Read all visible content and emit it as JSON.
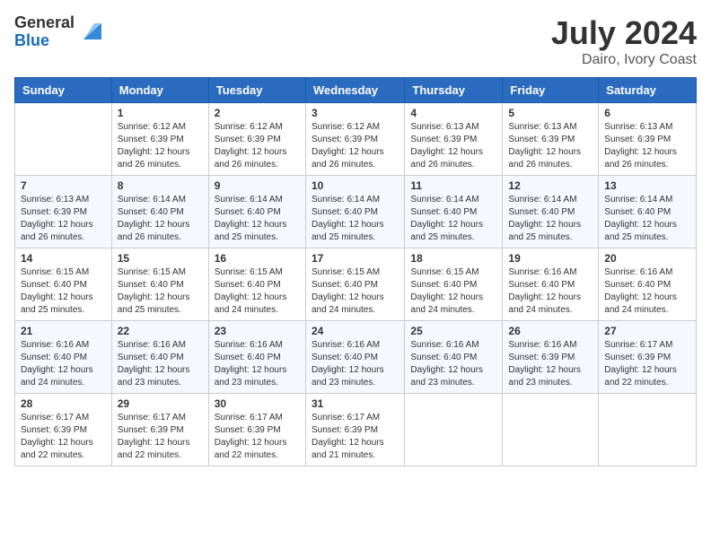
{
  "header": {
    "logo_general": "General",
    "logo_blue": "Blue",
    "month": "July 2024",
    "location": "Dairo, Ivory Coast"
  },
  "days_of_week": [
    "Sunday",
    "Monday",
    "Tuesday",
    "Wednesday",
    "Thursday",
    "Friday",
    "Saturday"
  ],
  "weeks": [
    [
      {
        "day": "",
        "sunrise": "",
        "sunset": "",
        "daylight": ""
      },
      {
        "day": "1",
        "sunrise": "Sunrise: 6:12 AM",
        "sunset": "Sunset: 6:39 PM",
        "daylight": "Daylight: 12 hours and 26 minutes."
      },
      {
        "day": "2",
        "sunrise": "Sunrise: 6:12 AM",
        "sunset": "Sunset: 6:39 PM",
        "daylight": "Daylight: 12 hours and 26 minutes."
      },
      {
        "day": "3",
        "sunrise": "Sunrise: 6:12 AM",
        "sunset": "Sunset: 6:39 PM",
        "daylight": "Daylight: 12 hours and 26 minutes."
      },
      {
        "day": "4",
        "sunrise": "Sunrise: 6:13 AM",
        "sunset": "Sunset: 6:39 PM",
        "daylight": "Daylight: 12 hours and 26 minutes."
      },
      {
        "day": "5",
        "sunrise": "Sunrise: 6:13 AM",
        "sunset": "Sunset: 6:39 PM",
        "daylight": "Daylight: 12 hours and 26 minutes."
      },
      {
        "day": "6",
        "sunrise": "Sunrise: 6:13 AM",
        "sunset": "Sunset: 6:39 PM",
        "daylight": "Daylight: 12 hours and 26 minutes."
      }
    ],
    [
      {
        "day": "7",
        "sunrise": "Sunrise: 6:13 AM",
        "sunset": "Sunset: 6:39 PM",
        "daylight": "Daylight: 12 hours and 26 minutes."
      },
      {
        "day": "8",
        "sunrise": "Sunrise: 6:14 AM",
        "sunset": "Sunset: 6:40 PM",
        "daylight": "Daylight: 12 hours and 26 minutes."
      },
      {
        "day": "9",
        "sunrise": "Sunrise: 6:14 AM",
        "sunset": "Sunset: 6:40 PM",
        "daylight": "Daylight: 12 hours and 25 minutes."
      },
      {
        "day": "10",
        "sunrise": "Sunrise: 6:14 AM",
        "sunset": "Sunset: 6:40 PM",
        "daylight": "Daylight: 12 hours and 25 minutes."
      },
      {
        "day": "11",
        "sunrise": "Sunrise: 6:14 AM",
        "sunset": "Sunset: 6:40 PM",
        "daylight": "Daylight: 12 hours and 25 minutes."
      },
      {
        "day": "12",
        "sunrise": "Sunrise: 6:14 AM",
        "sunset": "Sunset: 6:40 PM",
        "daylight": "Daylight: 12 hours and 25 minutes."
      },
      {
        "day": "13",
        "sunrise": "Sunrise: 6:14 AM",
        "sunset": "Sunset: 6:40 PM",
        "daylight": "Daylight: 12 hours and 25 minutes."
      }
    ],
    [
      {
        "day": "14",
        "sunrise": "Sunrise: 6:15 AM",
        "sunset": "Sunset: 6:40 PM",
        "daylight": "Daylight: 12 hours and 25 minutes."
      },
      {
        "day": "15",
        "sunrise": "Sunrise: 6:15 AM",
        "sunset": "Sunset: 6:40 PM",
        "daylight": "Daylight: 12 hours and 25 minutes."
      },
      {
        "day": "16",
        "sunrise": "Sunrise: 6:15 AM",
        "sunset": "Sunset: 6:40 PM",
        "daylight": "Daylight: 12 hours and 24 minutes."
      },
      {
        "day": "17",
        "sunrise": "Sunrise: 6:15 AM",
        "sunset": "Sunset: 6:40 PM",
        "daylight": "Daylight: 12 hours and 24 minutes."
      },
      {
        "day": "18",
        "sunrise": "Sunrise: 6:15 AM",
        "sunset": "Sunset: 6:40 PM",
        "daylight": "Daylight: 12 hours and 24 minutes."
      },
      {
        "day": "19",
        "sunrise": "Sunrise: 6:16 AM",
        "sunset": "Sunset: 6:40 PM",
        "daylight": "Daylight: 12 hours and 24 minutes."
      },
      {
        "day": "20",
        "sunrise": "Sunrise: 6:16 AM",
        "sunset": "Sunset: 6:40 PM",
        "daylight": "Daylight: 12 hours and 24 minutes."
      }
    ],
    [
      {
        "day": "21",
        "sunrise": "Sunrise: 6:16 AM",
        "sunset": "Sunset: 6:40 PM",
        "daylight": "Daylight: 12 hours and 24 minutes."
      },
      {
        "day": "22",
        "sunrise": "Sunrise: 6:16 AM",
        "sunset": "Sunset: 6:40 PM",
        "daylight": "Daylight: 12 hours and 23 minutes."
      },
      {
        "day": "23",
        "sunrise": "Sunrise: 6:16 AM",
        "sunset": "Sunset: 6:40 PM",
        "daylight": "Daylight: 12 hours and 23 minutes."
      },
      {
        "day": "24",
        "sunrise": "Sunrise: 6:16 AM",
        "sunset": "Sunset: 6:40 PM",
        "daylight": "Daylight: 12 hours and 23 minutes."
      },
      {
        "day": "25",
        "sunrise": "Sunrise: 6:16 AM",
        "sunset": "Sunset: 6:40 PM",
        "daylight": "Daylight: 12 hours and 23 minutes."
      },
      {
        "day": "26",
        "sunrise": "Sunrise: 6:16 AM",
        "sunset": "Sunset: 6:39 PM",
        "daylight": "Daylight: 12 hours and 23 minutes."
      },
      {
        "day": "27",
        "sunrise": "Sunrise: 6:17 AM",
        "sunset": "Sunset: 6:39 PM",
        "daylight": "Daylight: 12 hours and 22 minutes."
      }
    ],
    [
      {
        "day": "28",
        "sunrise": "Sunrise: 6:17 AM",
        "sunset": "Sunset: 6:39 PM",
        "daylight": "Daylight: 12 hours and 22 minutes."
      },
      {
        "day": "29",
        "sunrise": "Sunrise: 6:17 AM",
        "sunset": "Sunset: 6:39 PM",
        "daylight": "Daylight: 12 hours and 22 minutes."
      },
      {
        "day": "30",
        "sunrise": "Sunrise: 6:17 AM",
        "sunset": "Sunset: 6:39 PM",
        "daylight": "Daylight: 12 hours and 22 minutes."
      },
      {
        "day": "31",
        "sunrise": "Sunrise: 6:17 AM",
        "sunset": "Sunset: 6:39 PM",
        "daylight": "Daylight: 12 hours and 21 minutes."
      },
      {
        "day": "",
        "sunrise": "",
        "sunset": "",
        "daylight": ""
      },
      {
        "day": "",
        "sunrise": "",
        "sunset": "",
        "daylight": ""
      },
      {
        "day": "",
        "sunrise": "",
        "sunset": "",
        "daylight": ""
      }
    ]
  ]
}
